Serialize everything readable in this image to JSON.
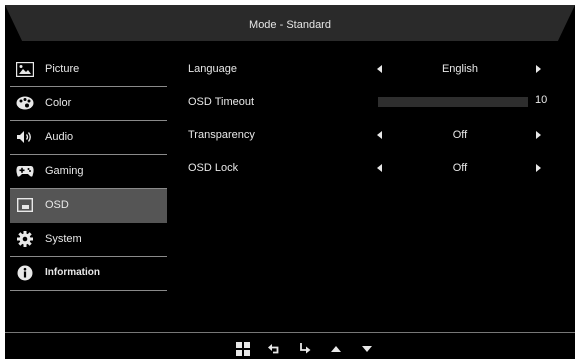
{
  "header": {
    "title": "Mode - Standard"
  },
  "sidebar": {
    "items": [
      {
        "label": "Picture",
        "icon": "picture-icon"
      },
      {
        "label": "Color",
        "icon": "palette-icon"
      },
      {
        "label": "Audio",
        "icon": "speaker-icon"
      },
      {
        "label": "Gaming",
        "icon": "gamepad-icon"
      },
      {
        "label": "OSD",
        "icon": "osd-icon",
        "selected": true
      },
      {
        "label": "System",
        "icon": "gear-icon"
      },
      {
        "label": "Information",
        "icon": "info-icon"
      }
    ]
  },
  "osd_settings": {
    "language": {
      "label": "Language",
      "value": "English"
    },
    "osd_timeout": {
      "label": "OSD Timeout",
      "value": "10",
      "fill_fraction": 0
    },
    "transparency": {
      "label": "Transparency",
      "value": "Off"
    },
    "osd_lock": {
      "label": "OSD Lock",
      "value": "Off"
    }
  },
  "footer": {
    "buttons": [
      "menu-grid-icon",
      "return-icon",
      "enter-icon",
      "up-arrow-icon",
      "down-arrow-icon"
    ]
  },
  "colors": {
    "background": "#000000",
    "header": "#2a2a2a",
    "selected": "#555555",
    "text": "#e8e8e8"
  }
}
